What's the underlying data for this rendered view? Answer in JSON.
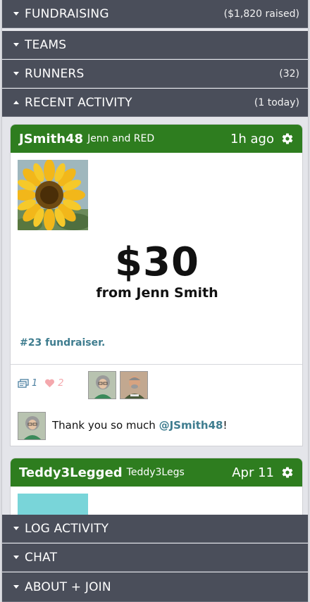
{
  "sections": {
    "fundraising": {
      "label": "FUNDRAISING",
      "count": "($1,820 raised)"
    },
    "teams": {
      "label": "TEAMS"
    },
    "runners": {
      "label": "RUNNERS",
      "count": "(32)"
    },
    "recent": {
      "label": "RECENT ACTIVITY",
      "count": "(1 today)"
    },
    "log": {
      "label": "LOG ACTIVITY"
    },
    "chat": {
      "label": "CHAT"
    },
    "about": {
      "label": "ABOUT + JOIN"
    }
  },
  "activity": [
    {
      "user": "JSmith48",
      "team": "Jenn and RED",
      "time": "1h ago",
      "amount": "$30",
      "from": "from Jenn Smith",
      "fundraiser": "#23 fundraiser.",
      "comments_count": "1",
      "likes_count": "2",
      "comment": {
        "text_before": "Thank you so much ",
        "mention": "@JSmith48",
        "text_after": "!"
      }
    },
    {
      "user": "Teddy3Legged",
      "team": "Teddy3Legs",
      "time": "Apr 11"
    }
  ],
  "colors": {
    "bar_bg": "#4a4e5a",
    "card_header": "#2e7d1f",
    "link": "#3f7d8f",
    "comment_icon": "#4c7fa0",
    "like_icon": "#f4a8ad",
    "placeholder_tile": "#79d5d9"
  },
  "icons": [
    "caret-down-icon",
    "caret-up-icon",
    "gear-icon",
    "comment-icon",
    "heart-icon"
  ]
}
